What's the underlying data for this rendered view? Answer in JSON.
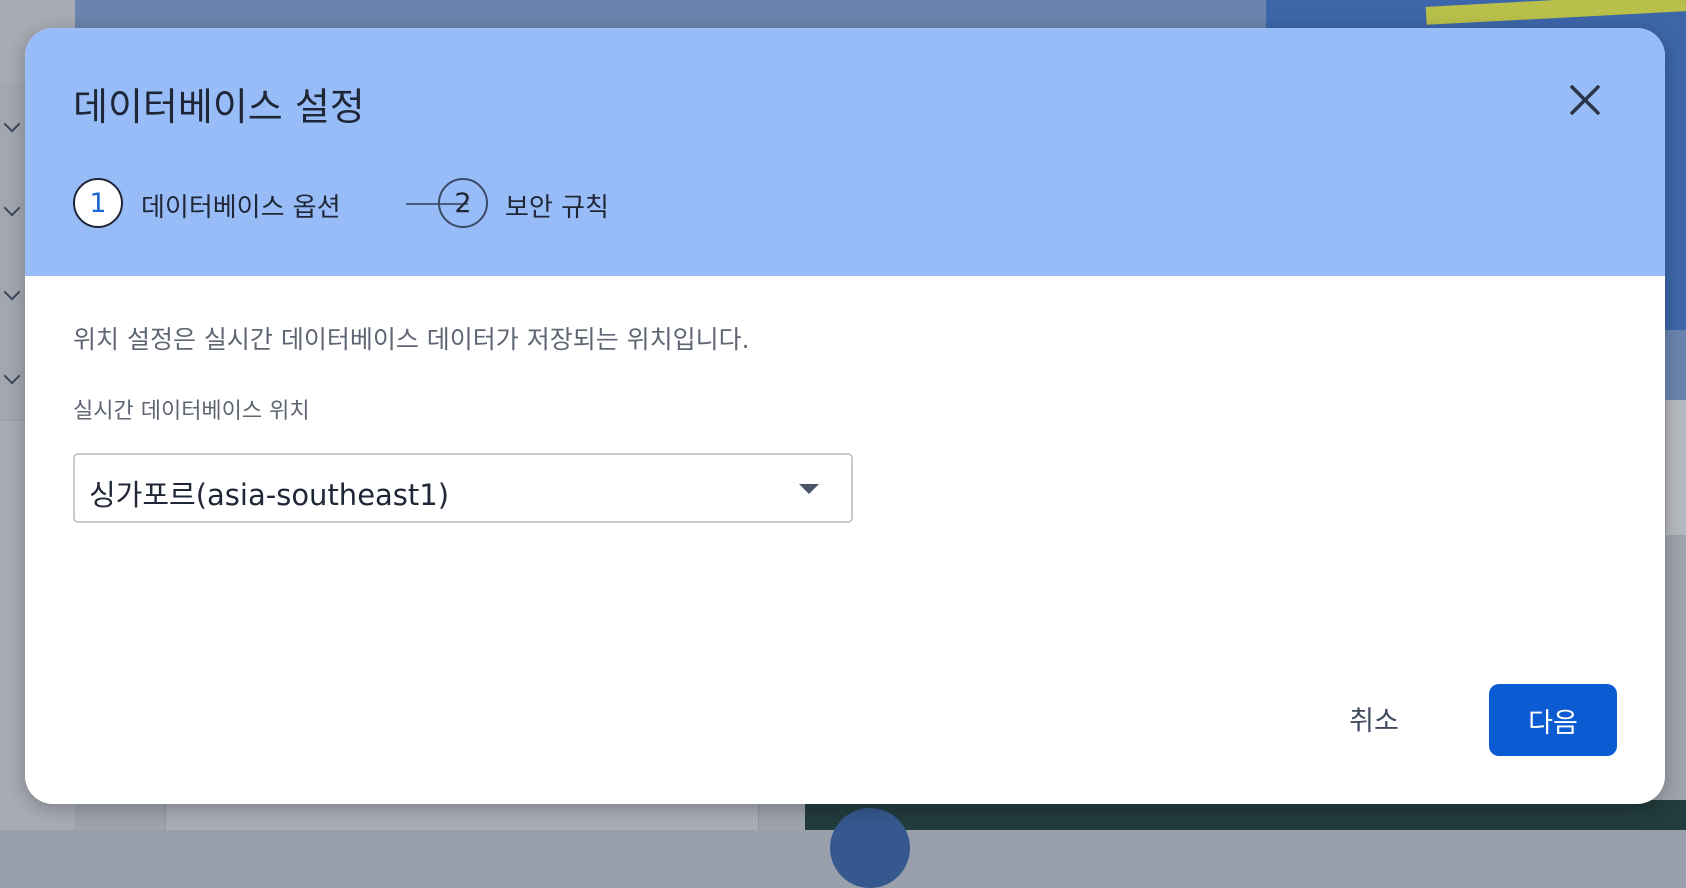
{
  "dialog": {
    "title": "데이터베이스 설정",
    "close_icon": "close-icon",
    "steps": [
      {
        "number": "1",
        "label": "데이터베이스 옵션",
        "state": "active"
      },
      {
        "number": "2",
        "label": "보안 규칙",
        "state": "pending"
      }
    ],
    "description": "위치 설정은 실시간 데이터베이스 데이터가 저장되는 위치입니다.",
    "location": {
      "label": "실시간 데이터베이스 위치",
      "selected_value": "싱가포르(asia-southeast1)"
    },
    "buttons": {
      "cancel": "취소",
      "next": "다음"
    }
  },
  "colors": {
    "header_background": "#98bcf8",
    "primary_button": "#0b5bd3",
    "active_step_number": "#1967d2"
  }
}
